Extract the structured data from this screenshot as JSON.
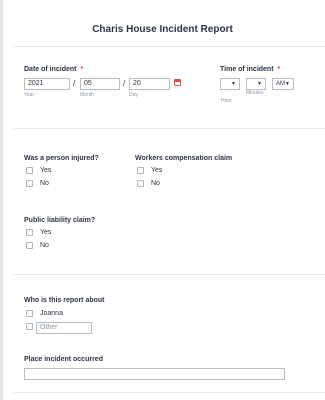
{
  "form": {
    "title": "Charis House Incident Report"
  },
  "date_of_incident": {
    "label": "Date of incident",
    "required_mark": "*",
    "year": {
      "value": "2021",
      "sublabel": "Year"
    },
    "month": {
      "value": "05",
      "sublabel": "Month"
    },
    "day": {
      "value": "20",
      "sublabel": "Day"
    },
    "separator": "/",
    "calendar_icon": "calendar-icon"
  },
  "time_of_incident": {
    "label": "Time of incident",
    "required_mark": "*",
    "hour": {
      "value": "",
      "sublabel": "Hour"
    },
    "colon": ":",
    "minutes": {
      "value": "",
      "sublabel": "Minutes"
    },
    "ampm": {
      "value": "AM"
    },
    "dropdown_icon": "caret-down-icon"
  },
  "injured": {
    "label": "Was a person injured?",
    "options": [
      "Yes",
      "No"
    ]
  },
  "workers_comp": {
    "label": "Workers compensation claim",
    "options": [
      "Yes",
      "No"
    ]
  },
  "public_liability": {
    "label": "Public liability claim?",
    "options": [
      "Yes",
      "No"
    ]
  },
  "report_about": {
    "label": "Who is this report about",
    "options": [
      "Joanna"
    ],
    "other_placeholder": "Other"
  },
  "place": {
    "label": "Place incident occurred",
    "value": ""
  }
}
